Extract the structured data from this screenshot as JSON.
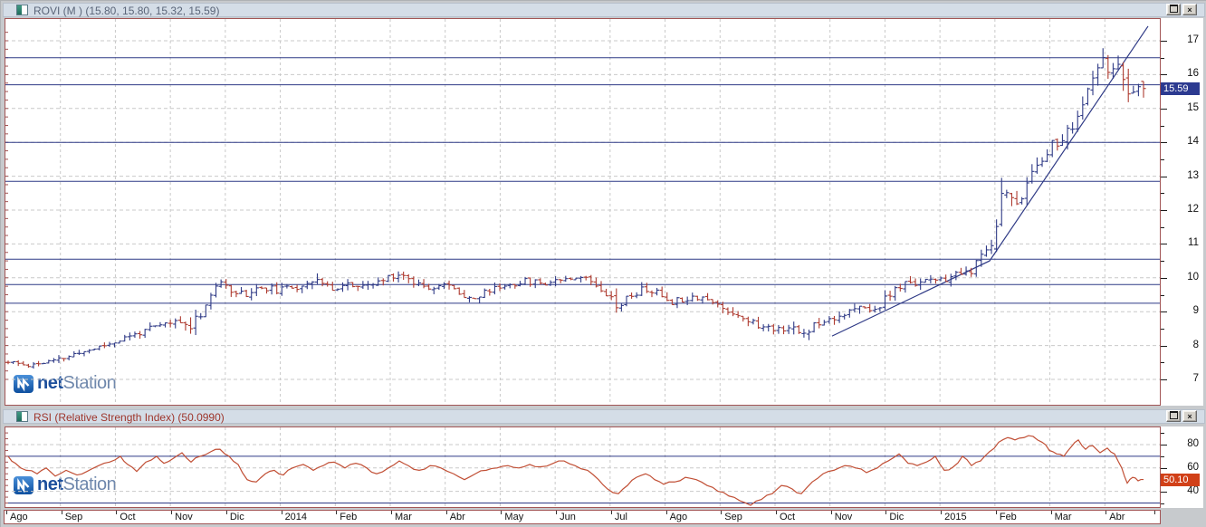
{
  "window": {
    "background": "#c7cacd",
    "titlebar_bg": "#d4dde7",
    "panel_border": "#a25555"
  },
  "main_panel": {
    "title": "ROVI (M ) (15.80, 15.80, 15.32, 15.59)",
    "title_color": "#5a6578",
    "close_label": "×"
  },
  "rsi_panel": {
    "title": "RSI (Relative Strength Index) (50.0990)",
    "title_color": "#9e352b",
    "close_label": "×"
  },
  "logo": {
    "net": "net",
    "station": "Station"
  },
  "chart_data": [
    {
      "type": "ohlc",
      "symbol": "ROVI",
      "timeframe": "M",
      "last_bar": [
        15.8,
        15.8,
        15.32,
        15.59
      ],
      "last_price_label": "15.59",
      "y_axis": {
        "min": 7,
        "max": 17,
        "tick_labels": [
          7,
          8,
          9,
          10,
          11,
          12,
          13,
          14,
          15,
          16,
          17
        ]
      },
      "x_labels": [
        "Ago",
        "Sep",
        "Oct",
        "Nov",
        "Dic",
        "2014",
        "Feb",
        "Mar",
        "Abr",
        "May",
        "Jun",
        "Jul",
        "Ago",
        "Sep",
        "Oct",
        "Nov",
        "Dic",
        "2015",
        "Feb",
        "Mar",
        "Abr"
      ],
      "grid": {
        "h_dashed_prices": [
          7,
          8,
          9,
          10,
          11,
          12,
          13,
          14,
          15,
          16,
          17
        ],
        "v_dashed_monthly": true,
        "legend": "none"
      },
      "support_resistance_lines": [
        16.5,
        15.7,
        14.0,
        12.85,
        10.55,
        9.8,
        9.25
      ],
      "trendline_x_price": [
        [
          918,
          8.28
        ],
        [
          1092,
          10.5
        ],
        [
          1267,
          17.43
        ]
      ],
      "price_path_x_close_range": [
        [
          8,
          7.5,
          0.18
        ],
        [
          30,
          7.42,
          0.18
        ],
        [
          60,
          7.55,
          0.2
        ],
        [
          95,
          7.85,
          0.22
        ],
        [
          125,
          8.1,
          0.22
        ],
        [
          160,
          8.45,
          0.24
        ],
        [
          190,
          8.7,
          0.26
        ],
        [
          208,
          8.6,
          0.5
        ],
        [
          222,
          9.0,
          0.35
        ],
        [
          238,
          9.8,
          0.32
        ],
        [
          252,
          9.72,
          0.34
        ],
        [
          268,
          9.5,
          0.3
        ],
        [
          288,
          9.72,
          0.3
        ],
        [
          308,
          9.62,
          0.28
        ],
        [
          328,
          9.75,
          0.3
        ],
        [
          346,
          10.0,
          0.38
        ],
        [
          362,
          9.68,
          0.3
        ],
        [
          382,
          9.82,
          0.3
        ],
        [
          400,
          9.7,
          0.28
        ],
        [
          420,
          9.9,
          0.3
        ],
        [
          437,
          10.15,
          0.32
        ],
        [
          455,
          9.9,
          0.3
        ],
        [
          472,
          9.75,
          0.3
        ],
        [
          490,
          9.8,
          0.28
        ],
        [
          508,
          9.55,
          0.3
        ],
        [
          524,
          9.38,
          0.3
        ],
        [
          540,
          9.65,
          0.28
        ],
        [
          560,
          9.8,
          0.26
        ],
        [
          580,
          9.9,
          0.26
        ],
        [
          600,
          9.85,
          0.26
        ],
        [
          620,
          10.0,
          0.26
        ],
        [
          640,
          10.05,
          0.26
        ],
        [
          656,
          9.85,
          0.28
        ],
        [
          668,
          9.6,
          0.32
        ],
        [
          680,
          9.2,
          0.45
        ],
        [
          695,
          9.45,
          0.3
        ],
        [
          710,
          9.68,
          0.3
        ],
        [
          725,
          9.55,
          0.3
        ],
        [
          740,
          9.3,
          0.3
        ],
        [
          758,
          9.42,
          0.28
        ],
        [
          775,
          9.45,
          0.26
        ],
        [
          790,
          9.2,
          0.3
        ],
        [
          806,
          9.0,
          0.3
        ],
        [
          822,
          8.82,
          0.3
        ],
        [
          838,
          8.55,
          0.3
        ],
        [
          855,
          8.5,
          0.28
        ],
        [
          870,
          8.55,
          0.3
        ],
        [
          885,
          8.3,
          0.62
        ],
        [
          900,
          8.68,
          0.3
        ],
        [
          915,
          8.8,
          0.3
        ],
        [
          932,
          8.95,
          0.3
        ],
        [
          950,
          9.1,
          0.3
        ],
        [
          965,
          9.05,
          0.3
        ],
        [
          980,
          9.45,
          0.36
        ],
        [
          995,
          9.78,
          0.34
        ],
        [
          1010,
          9.85,
          0.3
        ],
        [
          1022,
          10.0,
          0.3
        ],
        [
          1035,
          9.85,
          0.3
        ],
        [
          1048,
          10.02,
          0.3
        ],
        [
          1060,
          10.1,
          0.3
        ],
        [
          1072,
          10.2,
          0.32
        ],
        [
          1085,
          10.65,
          0.45
        ],
        [
          1095,
          11.1,
          0.55
        ],
        [
          1103,
          12.35,
          1.9
        ],
        [
          1112,
          12.45,
          0.55
        ],
        [
          1122,
          12.3,
          0.5
        ],
        [
          1132,
          12.6,
          0.5
        ],
        [
          1142,
          13.25,
          0.55
        ],
        [
          1152,
          13.7,
          0.5
        ],
        [
          1162,
          13.95,
          0.45
        ],
        [
          1172,
          14.05,
          0.45
        ],
        [
          1182,
          14.4,
          0.48
        ],
        [
          1192,
          14.9,
          0.5
        ],
        [
          1200,
          15.45,
          0.5
        ],
        [
          1208,
          15.95,
          0.52
        ],
        [
          1216,
          16.35,
          0.6
        ],
        [
          1224,
          16.2,
          0.5
        ],
        [
          1232,
          16.3,
          0.5
        ],
        [
          1240,
          15.55,
          0.95
        ],
        [
          1248,
          15.45,
          0.45
        ],
        [
          1256,
          15.5,
          0.4
        ],
        [
          1262,
          15.59,
          0.48
        ]
      ],
      "colors": {
        "up": "#2f3a86",
        "down": "#ae3b30",
        "grid_navy": "#2f3a86",
        "grid_gray": "#c9c9c9",
        "tag_bg": "#2c3a90",
        "trend": "#2f3a86"
      }
    },
    {
      "type": "line",
      "name": "RSI (Relative Strength Index)",
      "current_value": "50.0990",
      "tag_label": "50.10",
      "y_axis": {
        "tick_labels": [
          40,
          60,
          80
        ]
      },
      "ref_lines": {
        "solid": [
          70,
          30
        ],
        "dashed": [
          80,
          60,
          40
        ]
      },
      "series_x_value": [
        [
          8,
          70
        ],
        [
          16,
          64
        ],
        [
          28,
          58
        ],
        [
          40,
          55
        ],
        [
          50,
          60
        ],
        [
          60,
          53
        ],
        [
          72,
          58
        ],
        [
          84,
          54
        ],
        [
          95,
          57
        ],
        [
          108,
          62
        ],
        [
          120,
          65
        ],
        [
          132,
          70
        ],
        [
          140,
          63
        ],
        [
          150,
          57
        ],
        [
          160,
          65
        ],
        [
          172,
          70
        ],
        [
          180,
          64
        ],
        [
          190,
          68
        ],
        [
          200,
          73
        ],
        [
          210,
          65
        ],
        [
          220,
          70
        ],
        [
          232,
          74
        ],
        [
          242,
          76
        ],
        [
          252,
          70
        ],
        [
          262,
          63
        ],
        [
          272,
          50
        ],
        [
          282,
          48
        ],
        [
          292,
          55
        ],
        [
          302,
          58
        ],
        [
          312,
          54
        ],
        [
          322,
          60
        ],
        [
          334,
          63
        ],
        [
          345,
          58
        ],
        [
          356,
          62
        ],
        [
          368,
          65
        ],
        [
          380,
          60
        ],
        [
          392,
          64
        ],
        [
          404,
          60
        ],
        [
          415,
          55
        ],
        [
          428,
          60
        ],
        [
          440,
          66
        ],
        [
          450,
          62
        ],
        [
          462,
          58
        ],
        [
          474,
          62
        ],
        [
          486,
          60
        ],
        [
          500,
          55
        ],
        [
          512,
          50
        ],
        [
          524,
          55
        ],
        [
          536,
          58
        ],
        [
          548,
          60
        ],
        [
          560,
          62
        ],
        [
          572,
          60
        ],
        [
          584,
          63
        ],
        [
          596,
          61
        ],
        [
          610,
          64
        ],
        [
          622,
          66
        ],
        [
          634,
          62
        ],
        [
          648,
          58
        ],
        [
          660,
          50
        ],
        [
          670,
          42
        ],
        [
          682,
          38
        ],
        [
          692,
          45
        ],
        [
          702,
          52
        ],
        [
          712,
          55
        ],
        [
          722,
          50
        ],
        [
          732,
          46
        ],
        [
          744,
          48
        ],
        [
          756,
          52
        ],
        [
          768,
          50
        ],
        [
          780,
          45
        ],
        [
          792,
          40
        ],
        [
          804,
          36
        ],
        [
          816,
          32
        ],
        [
          828,
          28
        ],
        [
          840,
          33
        ],
        [
          852,
          38
        ],
        [
          862,
          45
        ],
        [
          874,
          42
        ],
        [
          884,
          38
        ],
        [
          896,
          48
        ],
        [
          908,
          55
        ],
        [
          920,
          58
        ],
        [
          932,
          62
        ],
        [
          944,
          60
        ],
        [
          956,
          56
        ],
        [
          968,
          60
        ],
        [
          980,
          66
        ],
        [
          992,
          72
        ],
        [
          1002,
          64
        ],
        [
          1012,
          62
        ],
        [
          1022,
          65
        ],
        [
          1032,
          70
        ],
        [
          1042,
          58
        ],
        [
          1052,
          61
        ],
        [
          1062,
          70
        ],
        [
          1072,
          62
        ],
        [
          1082,
          66
        ],
        [
          1092,
          74
        ],
        [
          1102,
          82
        ],
        [
          1112,
          86
        ],
        [
          1120,
          84
        ],
        [
          1130,
          86
        ],
        [
          1140,
          87
        ],
        [
          1150,
          82
        ],
        [
          1158,
          75
        ],
        [
          1166,
          72
        ],
        [
          1174,
          70
        ],
        [
          1182,
          78
        ],
        [
          1190,
          84
        ],
        [
          1198,
          76
        ],
        [
          1206,
          79
        ],
        [
          1214,
          73
        ],
        [
          1222,
          77
        ],
        [
          1230,
          72
        ],
        [
          1238,
          60
        ],
        [
          1244,
          47
        ],
        [
          1250,
          52
        ],
        [
          1256,
          49
        ],
        [
          1262,
          50.1
        ]
      ],
      "colors": {
        "line": "#c14f35",
        "tag_bg": "#d14018"
      }
    }
  ]
}
